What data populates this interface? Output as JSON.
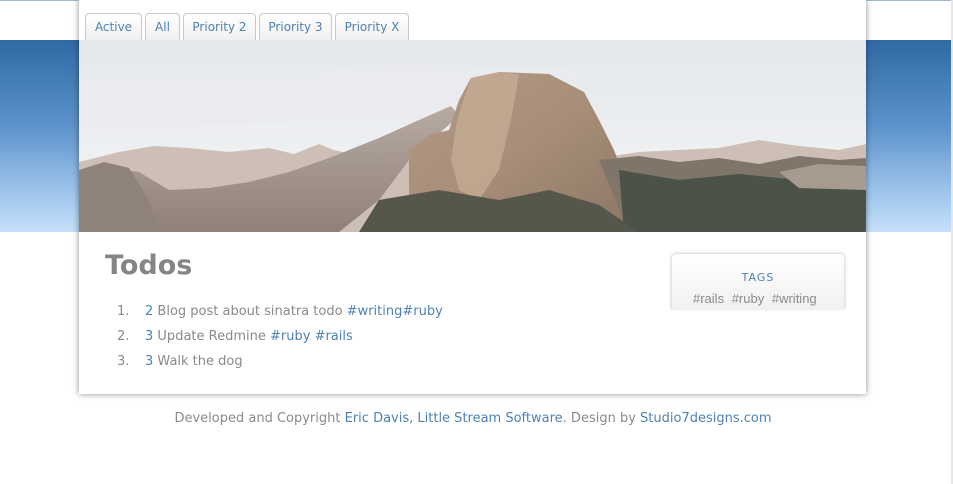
{
  "tabs": [
    {
      "label": "Active"
    },
    {
      "label": "All"
    },
    {
      "label": "Priority 2"
    },
    {
      "label": "Priority 3"
    },
    {
      "label": "Priority X"
    }
  ],
  "page": {
    "title": "Todos"
  },
  "todos": [
    {
      "index": "1.",
      "priority": "2",
      "text": "Blog post about sinatra todo",
      "tags": [
        "#writing",
        "#ruby"
      ]
    },
    {
      "index": "2.",
      "priority": "3",
      "text": "Update Redmine",
      "tags": [
        "#ruby",
        "#rails"
      ]
    },
    {
      "index": "3.",
      "priority": "3",
      "text": "Walk the dog",
      "tags": []
    }
  ],
  "sidebar": {
    "tags_title": "TAGS",
    "tags": [
      "#rails",
      "#ruby",
      "#writing"
    ]
  },
  "footer": {
    "prefix": "Developed and Copyright",
    "author_link": "Eric Davis, Little Stream Software",
    "middle": ". Design by",
    "design_link": "Studio7designs.com"
  },
  "colors": {
    "link": "#4d82b4",
    "text": "#8a8a8a",
    "band_top": "#2f6aa5",
    "band_bottom": "#c6e0fb"
  }
}
